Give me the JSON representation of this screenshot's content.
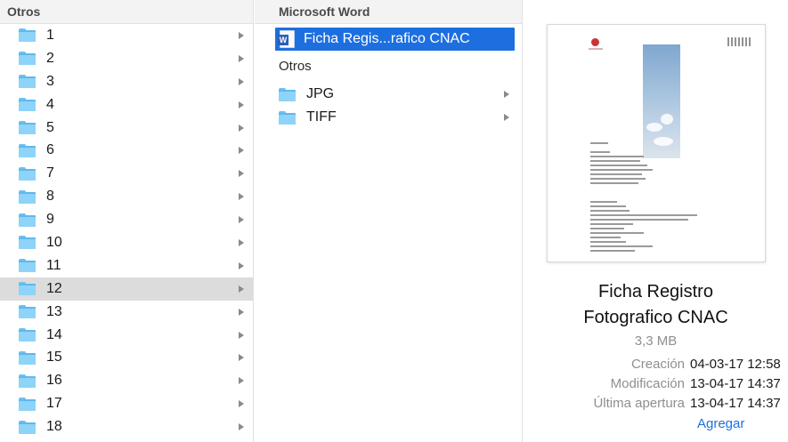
{
  "column1": {
    "header": "Otros",
    "items": [
      "1",
      "2",
      "3",
      "4",
      "5",
      "6",
      "7",
      "8",
      "9",
      "10",
      "11",
      "12",
      "13",
      "14",
      "15",
      "16",
      "17",
      "18"
    ],
    "selected_index": 11
  },
  "column2": {
    "header": "Microsoft Word",
    "selected_file": "Ficha Regis...rafico CNAC",
    "subheader": "Otros",
    "folders": [
      "JPG",
      "TIFF"
    ]
  },
  "preview": {
    "title_line1": "Ficha Registro",
    "title_line2": "Fotografico CNAC",
    "size": "3,3 MB",
    "labels": {
      "created": "Creación",
      "modified": "Modificación",
      "opened": "Última apertura"
    },
    "values": {
      "created": "04-03-17 12:58",
      "modified": "13-04-17 14:37",
      "opened": "13-04-17 14:37"
    },
    "add_label": "Agregar"
  },
  "colors": {
    "selection_blue": "#1d6fe0",
    "selection_grey": "#dcdcdc",
    "folder_blue": "#8ed3f8"
  }
}
